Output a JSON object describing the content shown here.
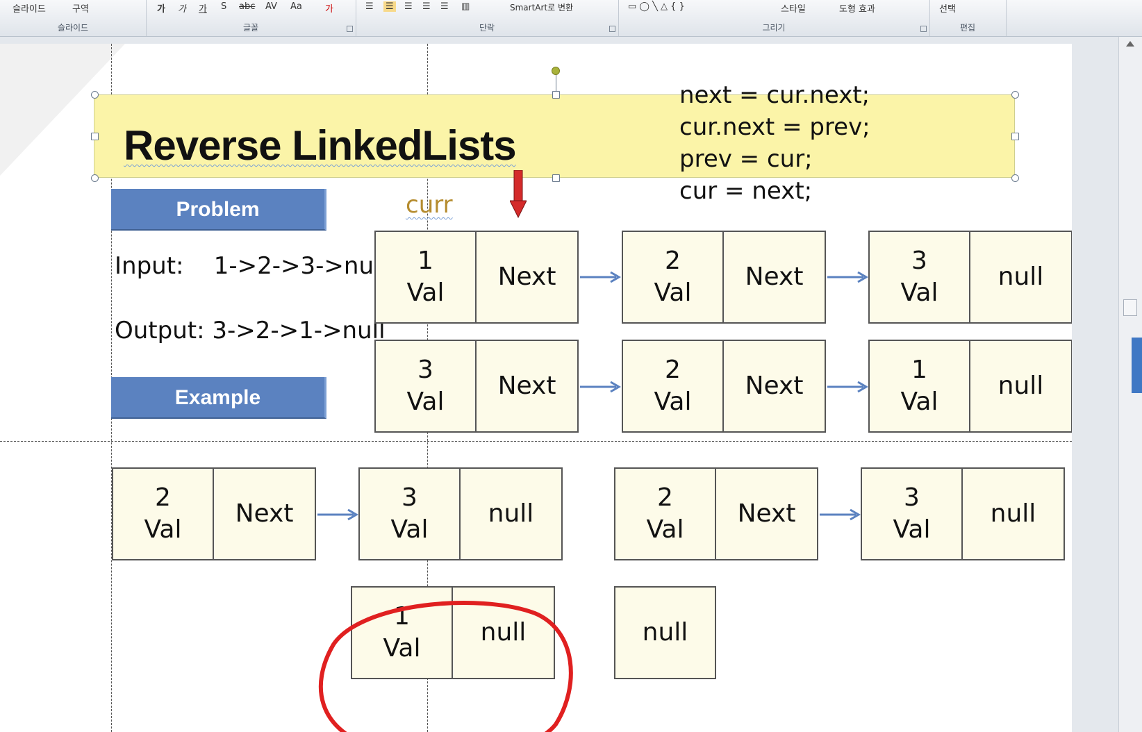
{
  "ribbon": {
    "groups": [
      {
        "label": "슬라이드",
        "tools": [
          "슬라이드",
          "구역"
        ]
      },
      {
        "label": "글꼴",
        "tools": [
          "가",
          "가",
          "가",
          "S",
          "abc",
          "AV",
          "Aa",
          "가"
        ]
      },
      {
        "label": "단락",
        "tools": [
          "SmartArt로 변환"
        ]
      },
      {
        "label": "그리기",
        "tools": [
          "스타일",
          "도형 효과"
        ]
      },
      {
        "label": "편집",
        "tools": [
          "선택"
        ]
      }
    ]
  },
  "slide": {
    "title": "Reverse LinkedLists",
    "code": [
      "next = cur.next;",
      "cur.next = prev;",
      "prev = cur;",
      "cur = next;"
    ],
    "curr_label": "curr",
    "problem_label": "Problem",
    "example_label": "Example",
    "input_text": "Input:    1->2->3->null",
    "output_text": "Output: 3->2->1->null",
    "rows": [
      {
        "nodes": [
          [
            "1",
            "Val",
            "Next"
          ],
          [
            "2",
            "Val",
            "Next"
          ],
          [
            "3",
            "Val",
            "null"
          ]
        ]
      },
      {
        "nodes": [
          [
            "3",
            "Val",
            "Next"
          ],
          [
            "2",
            "Val",
            "Next"
          ],
          [
            "1",
            "Val",
            "null"
          ]
        ]
      },
      {
        "nodes": [
          [
            "2",
            "Val",
            "Next"
          ],
          [
            "3",
            "Val",
            "null"
          ]
        ]
      },
      {
        "nodes": [
          [
            "2",
            "Val",
            "Next"
          ],
          [
            "3",
            "Val",
            "null"
          ]
        ]
      }
    ],
    "circled_node": [
      "1",
      "Val",
      "null"
    ],
    "lone_null": "null"
  },
  "colors": {
    "title_fill": "#fbf4a8",
    "banner": "#5b82c0",
    "node_fill": "#fdfbe9",
    "arrow": "#5b82c0",
    "annotation": "#e02020"
  }
}
